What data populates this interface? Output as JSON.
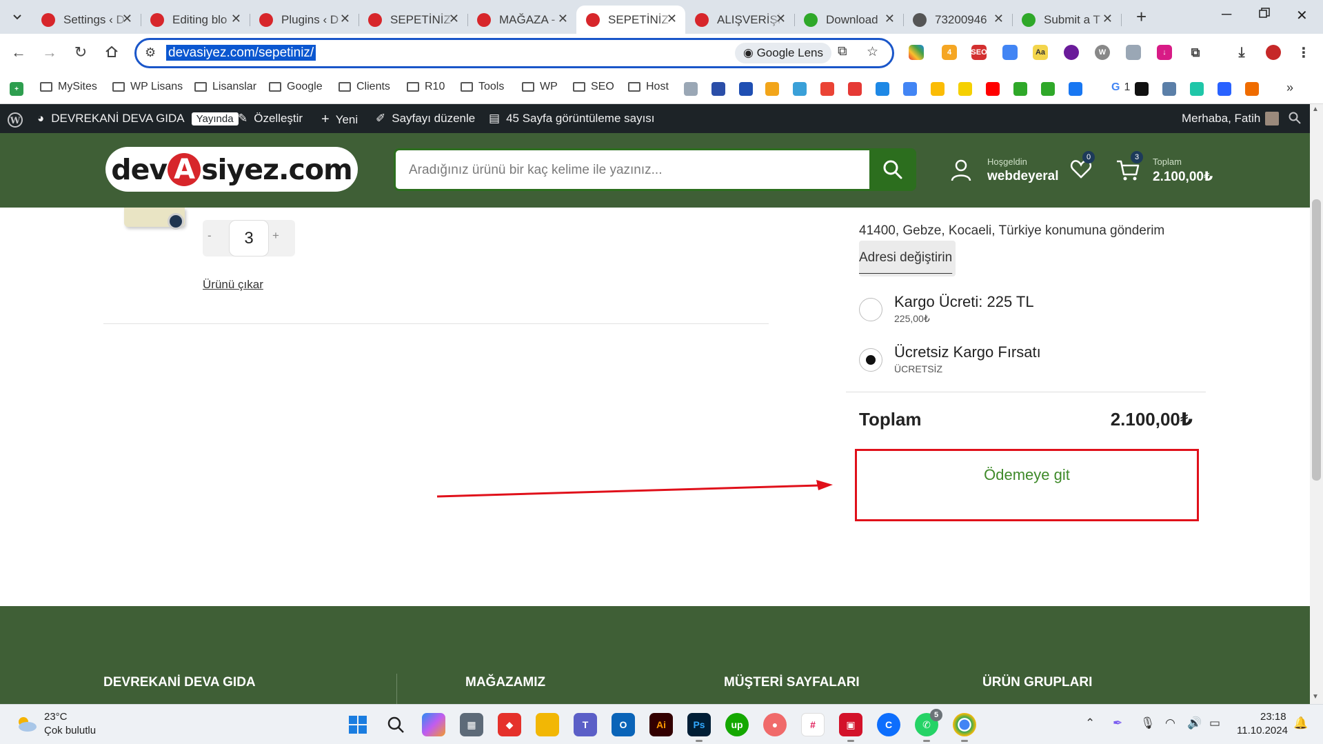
{
  "browser": {
    "tabs": [
      {
        "title": "Settings ‹ D",
        "icon": "site-logo-icon",
        "color": "#d7262b"
      },
      {
        "title": "Editing blo",
        "icon": "site-logo-icon",
        "color": "#d7262b"
      },
      {
        "title": "Plugins ‹ D",
        "icon": "site-logo-icon",
        "color": "#d7262b"
      },
      {
        "title": "SEPETİNİZ",
        "icon": "site-logo-icon",
        "color": "#d7262b"
      },
      {
        "title": "MAĞAZA -",
        "icon": "site-logo-icon",
        "color": "#d7262b"
      },
      {
        "title": "SEPETİNİZ",
        "icon": "site-logo-icon",
        "color": "#d7262b",
        "active": true
      },
      {
        "title": "ALIŞVERİŞİ",
        "icon": "site-logo-icon",
        "color": "#d7262b"
      },
      {
        "title": "Download",
        "icon": "download-site-icon",
        "color": "#2fa829"
      },
      {
        "title": "73200946",
        "icon": "globe-icon",
        "color": "#555555"
      },
      {
        "title": "Submit a T",
        "icon": "ticket-icon",
        "color": "#2fa829"
      }
    ],
    "url": "devasiyez.com/sepetiniz/",
    "lens_label": "Google Lens",
    "bookmarks": {
      "folders": [
        "MySites",
        "WP Lisans",
        "Lisanslar",
        "Google",
        "Clients",
        "R10",
        "Tools",
        "WP",
        "SEO",
        "Host"
      ],
      "g_count": "1"
    }
  },
  "wp_admin_bar": {
    "site_name": "DEVREKANİ DEVA GIDA",
    "status": "Yayında",
    "customize": "Özelleştir",
    "new": "Yeni",
    "edit_page": "Sayfayı düzenle",
    "views": "45 Sayfa görüntüleme sayısı",
    "greeting": "Merhaba, Fatih"
  },
  "site_header": {
    "logo_left": "dev",
    "logo_mid": "A",
    "logo_right": "siyez.com",
    "search_placeholder": "Aradığınız ürünü bir kaç kelime ile yazınız...",
    "user_greeting": "Hoşgeldin",
    "user_name": "webdeyeral",
    "wishlist_count": "0",
    "cart_count": "3",
    "total_label": "Toplam",
    "total_value": "2.100,00₺"
  },
  "cart": {
    "quantity": "3",
    "qty_minus": "-",
    "qty_plus": "+",
    "remove_label": "Ürünü çıkar"
  },
  "shipping": {
    "address": "41400, Gebze, Kocaeli, Türkiye konumuna gönderim",
    "change_address": "Adresi değiştirin",
    "options": [
      {
        "title": "Kargo Ücreti: 225 TL",
        "sub": "225,00₺",
        "selected": false
      },
      {
        "title": "Ücretsiz Kargo Fırsatı",
        "sub": "ÜCRETSİZ",
        "selected": true
      }
    ]
  },
  "summary": {
    "total_label": "Toplam",
    "total_value": "2.100,00₺",
    "checkout_label": "Ödemeye git"
  },
  "annotation": {
    "color": "#e0101a"
  },
  "footer": {
    "columns": [
      "DEVREKANİ DEVA GIDA",
      "MAĞAZAMIZ",
      "MÜŞTERİ SAYFALARI",
      "ÜRÜN GRUPLARI"
    ]
  },
  "taskbar": {
    "temperature": "23°C",
    "weather": "Çok bulutlu",
    "whatsapp_badge": "5",
    "time": "23:18",
    "date": "11.10.2024"
  },
  "colors": {
    "brand_green": "#3f5f36",
    "button_green": "#2c6e1e",
    "accent_red": "#d7262b"
  }
}
